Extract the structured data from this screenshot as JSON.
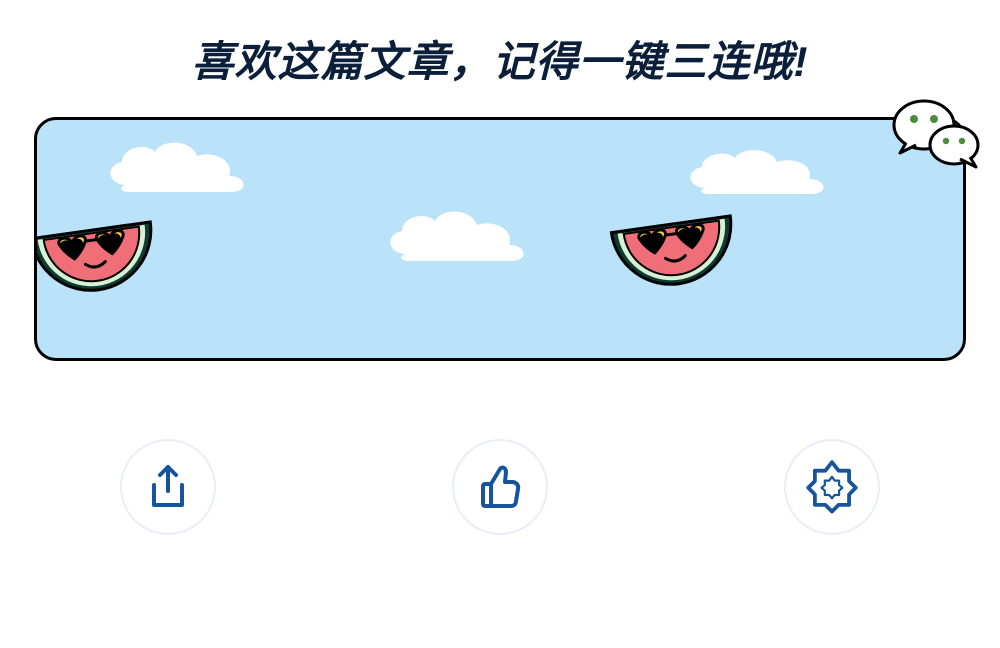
{
  "title": "喜欢这篇文章，记得一键三连哦!",
  "colors": {
    "sky": "#bae3f9",
    "title": "#0b1f3b",
    "iconBlue": "#17549e",
    "circle": "#e7eef6",
    "wechatDot": "#4a8e3c"
  },
  "icons": {
    "share": "share-icon",
    "like": "thumbs-up-icon",
    "star": "flower-star-icon",
    "chat": "wechat-icon",
    "watermelon": "watermelon-icon",
    "cloud": "cloud-icon"
  },
  "actions": [
    {
      "name": "share-button",
      "icon": "share-icon"
    },
    {
      "name": "like-button",
      "icon": "thumbs-up-icon"
    },
    {
      "name": "favorite-button",
      "icon": "flower-star-icon"
    }
  ]
}
